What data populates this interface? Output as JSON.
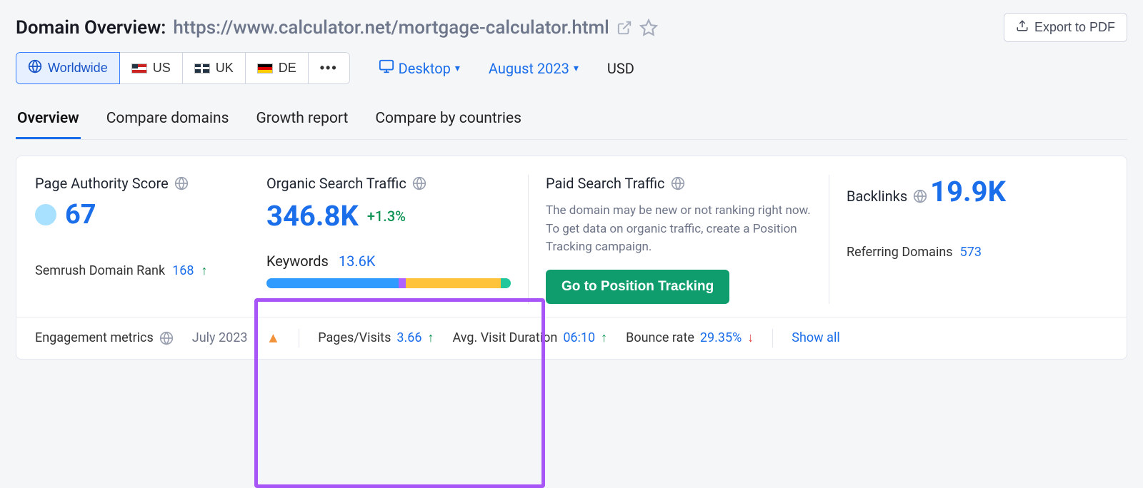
{
  "header": {
    "title_prefix": "Domain Overview: ",
    "url": "https://www.calculator.net/mortgage-calculator.html",
    "export_label": "Export to PDF"
  },
  "filters": {
    "countries": [
      "Worldwide",
      "US",
      "UK",
      "DE"
    ],
    "device_label": "Desktop",
    "date_label": "August 2023",
    "currency": "USD"
  },
  "tabs": [
    "Overview",
    "Compare domains",
    "Growth report",
    "Compare by countries"
  ],
  "metrics": {
    "page_authority": {
      "title": "Page Authority Score",
      "value": "67",
      "subrow_label": "Semrush Domain Rank",
      "subrow_value": "168"
    },
    "organic": {
      "title": "Organic Search Traffic",
      "value": "346.8K",
      "delta": "+1.3%",
      "keywords_label": "Keywords",
      "keywords_value": "13.6K"
    },
    "paid": {
      "title": "Paid Search Traffic",
      "text": "The domain may be new or not ranking right now. To get data on organic traffic, create a Position Tracking campaign.",
      "cta": "Go to Position Tracking"
    },
    "backlinks": {
      "title": "Backlinks",
      "value": "19.9K",
      "subrow_label": "Referring Domains",
      "subrow_value": "573"
    }
  },
  "engagement": {
    "label": "Engagement metrics",
    "month": "July 2023",
    "pages_visits_label": "Pages/Visits",
    "pages_visits_value": "3.66",
    "avg_duration_label": "Avg. Visit Duration",
    "avg_duration_value": "06:10",
    "bounce_label": "Bounce rate",
    "bounce_value": "29.35%",
    "show_all": "Show all"
  }
}
